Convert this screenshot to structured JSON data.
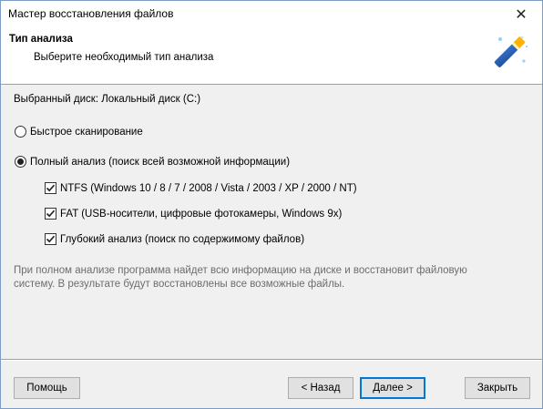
{
  "window": {
    "title": "Мастер восстановления файлов",
    "close_glyph": "✕"
  },
  "header": {
    "title": "Тип анализа",
    "subtitle": "Выберите необходимый тип анализа",
    "icon": "magic-wand-icon"
  },
  "content": {
    "disk_label": "Выбранный диск: Локальный диск (C:)",
    "scan_options": [
      {
        "label": "Быстрое сканирование",
        "selected": false
      },
      {
        "label": "Полный анализ (поиск всей возможной информации)",
        "selected": true
      }
    ],
    "checkboxes": [
      {
        "label": "NTFS (Windows 10 / 8 / 7 / 2008 / Vista / 2003 / XP / 2000 / NT)",
        "checked": true
      },
      {
        "label": "FAT (USB-носители, цифровые фотокамеры, Windows 9x)",
        "checked": true
      },
      {
        "label": "Глубокий анализ (поиск по содержимому файлов)",
        "checked": true
      }
    ],
    "info": "При полном анализе программа найдет всю информацию на диске и восстановит файловую систему. В результате будут восстановлены все возможные файлы."
  },
  "buttons": {
    "help": "Помощь",
    "back": "< Назад",
    "next": "Далее >",
    "close": "Закрыть"
  },
  "colors": {
    "accent": "#0078d7",
    "window_bg": "#f0f0f0",
    "info_text": "#6d6d6d"
  }
}
